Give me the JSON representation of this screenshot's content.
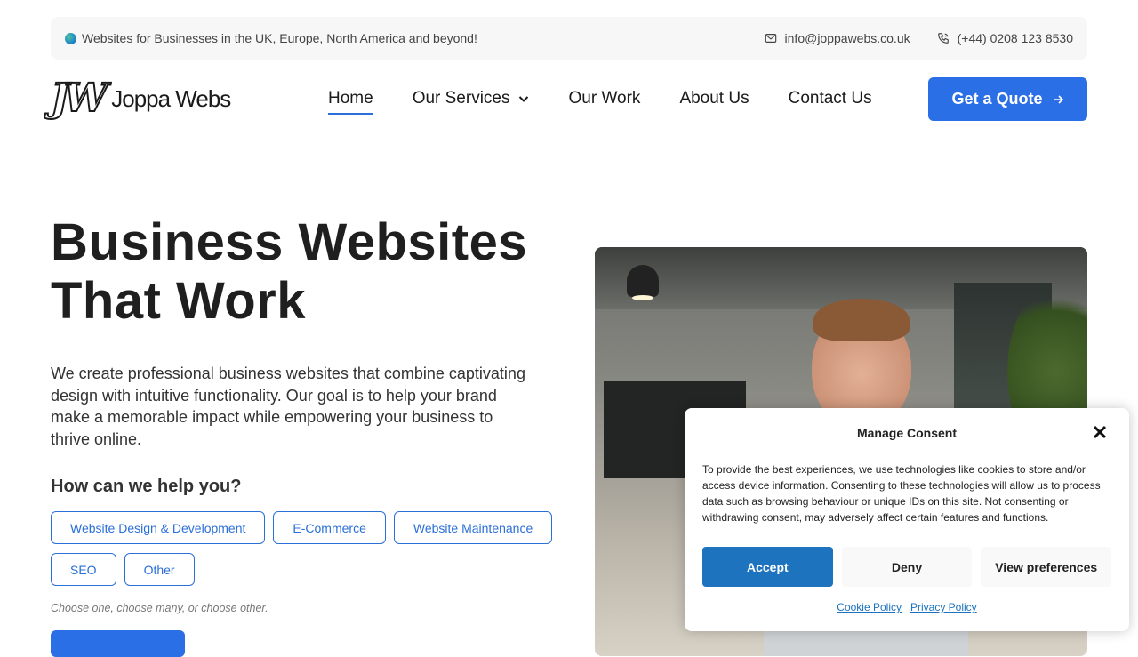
{
  "topbar": {
    "tagline": "Websites for Businesses in the UK, Europe, North America and beyond!",
    "email": "info@joppawebs.co.uk",
    "phone": "(+44) 0208 123 8530"
  },
  "brand": {
    "monogram": "JW",
    "name": "Joppa Webs"
  },
  "nav": {
    "items": [
      {
        "label": "Home"
      },
      {
        "label": "Our Services"
      },
      {
        "label": "Our Work"
      },
      {
        "label": "About Us"
      },
      {
        "label": "Contact Us"
      }
    ],
    "cta": "Get a Quote"
  },
  "hero": {
    "title_line1": "Business Websites",
    "title_line2": "That Work",
    "description": "We create professional business websites that combine captivating design with intuitive functionality. Our goal is to help your brand make a memorable impact while empowering your business to thrive online.",
    "help_title": "How can we help you?",
    "options": [
      "Website Design & Development",
      "E-Commerce",
      "Website Maintenance",
      "SEO",
      "Other"
    ],
    "hint": "Choose one, choose many, or choose other."
  },
  "consent": {
    "title": "Manage Consent",
    "text": "To provide the best experiences, we use technologies like cookies to store and/or access device information. Consenting to these technologies will allow us to process data such as browsing behaviour or unique IDs on this site. Not consenting or withdrawing consent, may adversely affect certain features and functions.",
    "accept": "Accept",
    "deny": "Deny",
    "preferences": "View preferences",
    "cookie_policy": "Cookie Policy",
    "privacy_policy": "Privacy Policy"
  },
  "colors": {
    "accent": "#2b6fe6",
    "consent_accent": "#1e73be"
  }
}
